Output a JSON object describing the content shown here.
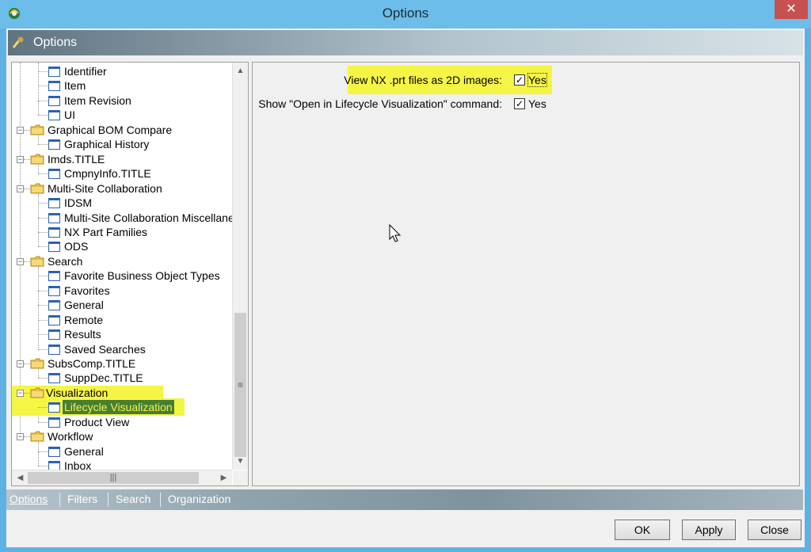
{
  "window": {
    "title": "Options",
    "close_glyph": "✕"
  },
  "banner": {
    "title": "Options"
  },
  "tree": [
    {
      "label": "Identifier",
      "level": 2,
      "type": "page"
    },
    {
      "label": "Item",
      "level": 2,
      "type": "page"
    },
    {
      "label": "Item Revision",
      "level": 2,
      "type": "page"
    },
    {
      "label": "UI",
      "level": 2,
      "type": "page"
    },
    {
      "label": "Graphical BOM Compare",
      "level": 1,
      "type": "folder"
    },
    {
      "label": "Graphical History",
      "level": 2,
      "type": "page"
    },
    {
      "label": "Imds.TITLE",
      "level": 1,
      "type": "folder"
    },
    {
      "label": "CmpnyInfo.TITLE",
      "level": 2,
      "type": "page"
    },
    {
      "label": "Multi-Site Collaboration",
      "level": 1,
      "type": "folder"
    },
    {
      "label": "IDSM",
      "level": 2,
      "type": "page"
    },
    {
      "label": "Multi-Site Collaboration Miscellane",
      "level": 2,
      "type": "page"
    },
    {
      "label": "NX Part Families",
      "level": 2,
      "type": "page"
    },
    {
      "label": "ODS",
      "level": 2,
      "type": "page"
    },
    {
      "label": "Search",
      "level": 1,
      "type": "folder"
    },
    {
      "label": "Favorite Business Object Types",
      "level": 2,
      "type": "page"
    },
    {
      "label": "Favorites",
      "level": 2,
      "type": "page"
    },
    {
      "label": "General",
      "level": 2,
      "type": "page"
    },
    {
      "label": "Remote",
      "level": 2,
      "type": "page"
    },
    {
      "label": "Results",
      "level": 2,
      "type": "page"
    },
    {
      "label": "Saved Searches",
      "level": 2,
      "type": "page"
    },
    {
      "label": "SubsComp.TITLE",
      "level": 1,
      "type": "folder"
    },
    {
      "label": "SuppDec.TITLE",
      "level": 2,
      "type": "page"
    },
    {
      "label": "Visualization",
      "level": 1,
      "type": "folder",
      "highlight": true
    },
    {
      "label": "Lifecycle Visualization",
      "level": 2,
      "type": "page",
      "selected": true,
      "highlight": true
    },
    {
      "label": "Product View",
      "level": 2,
      "type": "page"
    },
    {
      "label": "Workflow",
      "level": 1,
      "type": "folder"
    },
    {
      "label": "General",
      "level": 2,
      "type": "page"
    },
    {
      "label": "Inbox",
      "level": 2,
      "type": "page"
    }
  ],
  "settings": [
    {
      "label": "View NX .prt files as 2D images:",
      "checked": true,
      "value_label": "Yes",
      "highlight": true
    },
    {
      "label": "Show \"Open in Lifecycle Visualization\" command:",
      "checked": true,
      "value_label": "Yes",
      "highlight": false
    }
  ],
  "tabs": [
    {
      "label": "Options",
      "active": true
    },
    {
      "label": "Filters",
      "active": false
    },
    {
      "label": "Search",
      "active": false
    },
    {
      "label": "Organization",
      "active": false
    }
  ],
  "buttons": {
    "ok": "OK",
    "apply": "Apply",
    "close": "Close"
  },
  "colors": {
    "highlight": "#f5f545",
    "selection": "#477e32",
    "titlebar": "#6cbde9"
  }
}
